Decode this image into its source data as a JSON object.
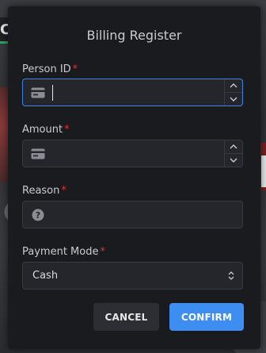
{
  "background": {
    "partial_heading_letter": "C"
  },
  "modal": {
    "title": "Billing Register",
    "fields": [
      {
        "label": "Person ID",
        "required": "*",
        "value": "",
        "icon": "id-card-icon"
      },
      {
        "label": "Amount",
        "required": "*",
        "value": "",
        "icon": "id-card-icon"
      },
      {
        "label": "Reason",
        "required": "*",
        "value": "",
        "icon": "question-circle-icon"
      },
      {
        "label": "Payment Mode",
        "required": "*",
        "selected": "Cash",
        "icon": "chevron-up-down-icon"
      }
    ],
    "buttons": {
      "cancel": "CANCEL",
      "confirm": "CONFIRM"
    }
  },
  "colors": {
    "modal_bg": "#1a1b1f",
    "input_bg": "#25262b",
    "focus_border": "#4185e4",
    "required": "#e03131",
    "confirm_bg": "#3d8ef0",
    "cancel_bg": "#2c2e33"
  }
}
